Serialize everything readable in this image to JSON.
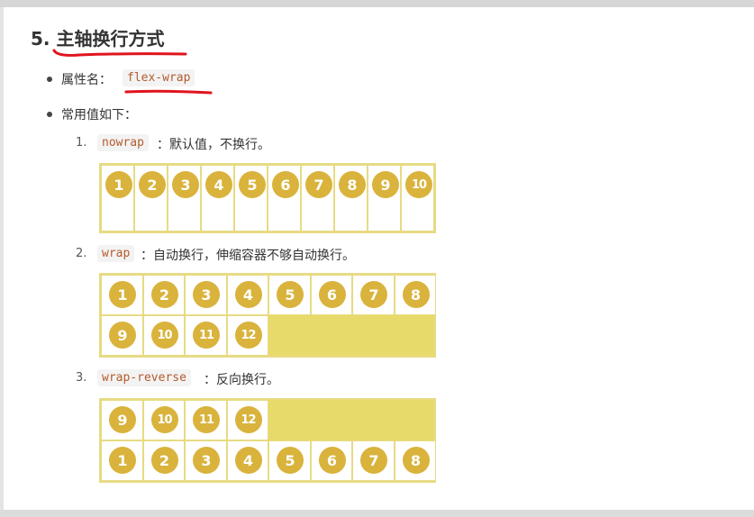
{
  "heading": {
    "number": "5.",
    "title": "主轴换行方式"
  },
  "bullets": [
    {
      "label": "属性名：",
      "code": "flex-wrap"
    },
    {
      "label": "常用值如下："
    }
  ],
  "items": [
    {
      "num": "1.",
      "code": "nowrap",
      "text": "：默认值，不换行。"
    },
    {
      "num": "2.",
      "code": "wrap",
      "text": "：自动换行，伸缩容器不够自动换行。"
    },
    {
      "num": "3.",
      "code": "wrap-reverse",
      "text": "：反向换行。"
    }
  ],
  "demo_nowrap": [
    "1",
    "2",
    "3",
    "4",
    "5",
    "6",
    "7",
    "8",
    "9",
    "10"
  ],
  "demo_wrap": [
    "1",
    "2",
    "3",
    "4",
    "5",
    "6",
    "7",
    "8",
    "9",
    "10",
    "11",
    "12"
  ],
  "demo_wrap_reverse": [
    "1",
    "2",
    "3",
    "4",
    "5",
    "6",
    "7",
    "8",
    "9",
    "10",
    "11",
    "12"
  ],
  "colors": {
    "container": "#e8d96b",
    "circle": "#d9b33c",
    "annotation": "#e0141c"
  }
}
